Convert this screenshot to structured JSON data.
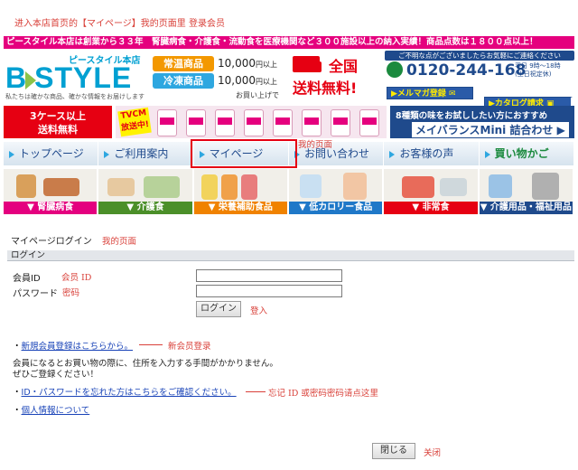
{
  "top_note": "进入本店首页的【マイページ】我的页面里  登录会员",
  "banner": {
    "ribbon": "ピースタイル本店は創業から３３年　腎臓病食・介護食・流動食を医療機関など３００施設以上の納入実績！商品点数は１８００点以上！",
    "logo_shop": "ピースタイル本店",
    "logo_b": "B",
    "logo_rest": "STYLE",
    "logo_sub": "私たちは確かな商品、確かな情報をお届けします",
    "tag_normal": "常温商品",
    "tag_frozen": "冷凍商品",
    "price1": "10,000",
    "price2": "10,000",
    "price_unit": "円以上",
    "price_note": "お買い上げで",
    "free_top": "全国",
    "free_main": "送料無料!",
    "contact_head": "ご不明な点がございましたらお気軽にご連絡ください",
    "phone": "0120-244-168",
    "hours1": "平日 9時～18時",
    "hours2": "(土日祝定休)",
    "mag_btn": "▶メルマガ登録 ✉",
    "cat_btn": "▶カタログ請求 ▣",
    "case_t1": "3ケース以上",
    "case_t2": "送料無料",
    "tvcm": "TVCM 放送中!",
    "meiba_t1": "8種類の味をお試ししたい方におすすめ",
    "meiba_t2": "メイバランスMini 詰合わせ ▶"
  },
  "nav": {
    "items": [
      {
        "label": "トップページ"
      },
      {
        "label": "ご利用案内"
      },
      {
        "label": "マイページ"
      },
      {
        "label": "お問い合わせ"
      },
      {
        "label": "お客様の声"
      },
      {
        "label": "買い物かご"
      }
    ],
    "highlight_note": "我的页面"
  },
  "categories": [
    {
      "label": "▼ 腎臓病食"
    },
    {
      "label": "▼ 介護食"
    },
    {
      "label": "▼ 栄養補助食品"
    },
    {
      "label": "▼ 低カロリー食品"
    },
    {
      "label": "▼ 非常食"
    },
    {
      "label": "▼ 介護用品・福祉用品"
    }
  ],
  "login": {
    "section_title": "マイページログイン",
    "section_note": "我的页面",
    "head_label": "ログイン",
    "id_label": "会員ID",
    "id_note": "会员 ID",
    "id_value": "",
    "pw_label": "パスワード",
    "pw_note": "密码",
    "pw_value": "",
    "login_button": "ログイン",
    "login_note": "登入"
  },
  "links": {
    "register_link": "新規会員登録はこちらから。",
    "register_note": "新会员登录",
    "info_line1": "会員になるとお買い物の際に、住所を入力する手間がかかりません。",
    "info_line2": "ぜひご登録ください！",
    "forgot_link": "ID・パスワードを忘れた方はこちらをご確認ください。",
    "forgot_note": "忘记 ID 或密码密码请点这里",
    "privacy_link": "個人情報について",
    "bullet": "・"
  },
  "footer": {
    "close_button": "閉じる",
    "close_note": "关闭"
  },
  "colors": {
    "annotation_red": "#d9413a",
    "link_blue": "#1a44b8",
    "brand_pink": "#e5007e",
    "brand_navy": "#1f4a8c"
  }
}
